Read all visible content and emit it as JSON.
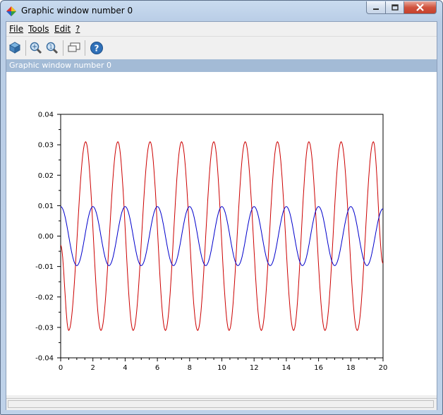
{
  "window": {
    "title": "Graphic window number 0"
  },
  "menu": [
    {
      "label": "File"
    },
    {
      "label": "Tools"
    },
    {
      "label": "Edit"
    },
    {
      "label": "?"
    }
  ],
  "toolbar": {
    "icons": [
      "rotate-icon",
      "zoom-icon",
      "unzoom-icon",
      "datatip-icon",
      "help-icon"
    ]
  },
  "figure": {
    "title": "Graphic window number 0"
  },
  "colors": {
    "series_red": "#cc0000",
    "series_blue": "#0000cc"
  },
  "chart_data": {
    "type": "line",
    "title": "",
    "xlabel": "",
    "ylabel": "",
    "xlim": [
      0,
      20
    ],
    "ylim": [
      -0.04,
      0.04
    ],
    "xticks": [
      "0",
      "2",
      "4",
      "6",
      "8",
      "10",
      "12",
      "14",
      "16",
      "18",
      "20"
    ],
    "yticks": [
      "-0.04",
      "-0.03",
      "-0.02",
      "-0.01",
      "0.00",
      "0.01",
      "0.02",
      "0.03",
      "0.04"
    ],
    "grid": false,
    "legend": "none",
    "series": [
      {
        "color": "#cc0000",
        "description": "oscillation, amplitude ~0.031, period ~2.0",
        "x": [
          0,
          0.5,
          1.0,
          1.5,
          2.0,
          2.5,
          3.0,
          3.5,
          4.0,
          4.5,
          5.0,
          5.5,
          6.0,
          6.5,
          7.0,
          7.5,
          8.0,
          8.5,
          9.0,
          9.5,
          10.0,
          10.5,
          11.0,
          11.5,
          12.0,
          12.5,
          13.0,
          13.5,
          14.0,
          14.5,
          15.0,
          15.5,
          16.0,
          16.5,
          17.0,
          17.5,
          18.0,
          18.5,
          19.0,
          19.5,
          20.0
        ],
        "y_peak_x": [
          1.55,
          3.55,
          5.55,
          7.5,
          9.5,
          11.45,
          13.45,
          15.4,
          17.4,
          19.4
        ],
        "y_trough_x": [
          0.5,
          2.5,
          4.5,
          6.5,
          8.5,
          10.45,
          12.45,
          14.45,
          16.4,
          18.4
        ],
        "amplitude": 0.031,
        "start_y": -0.003,
        "end_y": -0.009
      },
      {
        "color": "#0000cc",
        "description": "oscillation, amplitude ~0.0097, period ~2.0",
        "amplitude": 0.0097,
        "y_peak_x": [
          0,
          2.0,
          4.0,
          6.0,
          8.0,
          10.0,
          12.0,
          14.0,
          16.0,
          18.0
        ],
        "y_trough_x": [
          1.0,
          3.0,
          5.0,
          7.0,
          9.0,
          11.0,
          13.0,
          15.0,
          17.0,
          19.0
        ],
        "start_y": 0.01,
        "end_y": 0.009
      }
    ]
  }
}
